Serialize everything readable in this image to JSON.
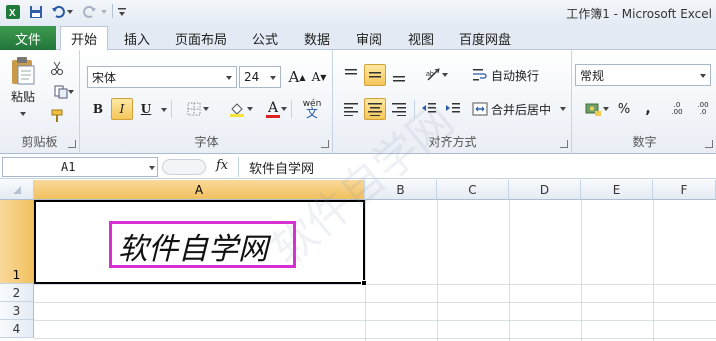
{
  "window": {
    "title": "工作簿1 - Microsoft Excel"
  },
  "quick_access": {
    "icons": [
      "excel-logo-icon",
      "save-icon",
      "undo-icon",
      "redo-icon",
      "customize-icon"
    ]
  },
  "tabs": {
    "file": "文件",
    "home": "开始",
    "insert": "插入",
    "page_layout": "页面布局",
    "formulas": "公式",
    "data": "数据",
    "review": "审阅",
    "view": "视图",
    "baidu": "百度网盘"
  },
  "ribbon": {
    "clipboard": {
      "paste": "粘贴",
      "label": "剪贴板"
    },
    "font": {
      "name": "宋体",
      "size": "24",
      "bold": "B",
      "italic": "I",
      "underline": "U",
      "font_color_glyph": "A",
      "phonetic": "wén",
      "grow": "A",
      "shrink": "A",
      "label": "字体"
    },
    "alignment": {
      "wrap_text": "自动换行",
      "merge_center": "合并后居中",
      "label": "对齐方式"
    },
    "number": {
      "format": "常规",
      "percent": "%",
      "comma": ",",
      "inc_decimal": ".0 .00",
      "dec_decimal": ".00 .0",
      "label": "数字"
    }
  },
  "formula_bar": {
    "name_box": "A1",
    "fx": "fx",
    "value": "软件自学网"
  },
  "grid": {
    "columns": [
      "A",
      "B",
      "C",
      "D",
      "E",
      "F"
    ],
    "rows": [
      "1",
      "2",
      "3",
      "4"
    ],
    "selected_cell": "A1",
    "cell_a1_text": "软件自学网",
    "accent_color": "#d92ed2"
  }
}
